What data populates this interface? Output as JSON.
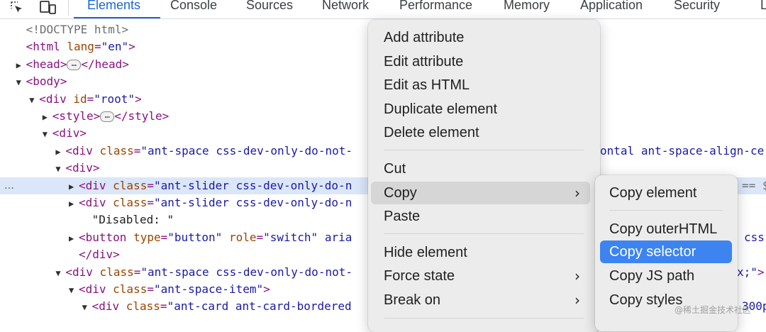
{
  "toolbar": {
    "tabs": [
      "Elements",
      "Console",
      "Sources",
      "Network",
      "Performance",
      "Memory",
      "Application",
      "Security",
      "L"
    ],
    "active_tab": "Elements",
    "accent_color": "#1a66d6"
  },
  "dom_tree": {
    "row_marker": "…",
    "lines": [
      {
        "indent": 1,
        "arrow": "",
        "code": "<!DOCTYPE html>"
      },
      {
        "indent": 1,
        "arrow": "",
        "code": "<html lang=\"en\">"
      },
      {
        "indent": 1,
        "arrow": "▶",
        "code": "<head>",
        "ellipsis": true,
        "code_after": "</head>"
      },
      {
        "indent": 1,
        "arrow": "▼",
        "code": "<body>"
      },
      {
        "indent": 2,
        "arrow": "▼",
        "code": "<div id=\"root\">"
      },
      {
        "indent": 3,
        "arrow": "▶",
        "code": "<style>",
        "ellipsis": true,
        "code_after": "</style>"
      },
      {
        "indent": 3,
        "arrow": "▼",
        "code": "<div>"
      },
      {
        "indent": 4,
        "arrow": "▶",
        "code": "<div class=\"ant-space css-dev-only-do-not-",
        "right": "ontal ant-space-align-ce"
      },
      {
        "indent": 4,
        "arrow": "▼",
        "code": "<div>"
      },
      {
        "indent": 5,
        "arrow": "▶",
        "code": "<div class=\"ant-slider css-dev-only-do-n",
        "right": "== $",
        "selected": true
      },
      {
        "indent": 5,
        "arrow": "▶",
        "code": "<div class=\"ant-slider css-dev-only-do-n"
      },
      {
        "indent": 6,
        "arrow": "",
        "code": "\"Disabled: \""
      },
      {
        "indent": 5,
        "arrow": "▶",
        "code": "<button type=\"button\" role=\"switch\" aria",
        "right": "css-"
      },
      {
        "indent": 5,
        "arrow": "",
        "code": "</div>"
      },
      {
        "indent": 4,
        "arrow": "▼",
        "code": "<div class=\"ant-space css-dev-only-do-not-",
        "right": "x;\">"
      },
      {
        "indent": 5,
        "arrow": "▼",
        "code": "<div class=\"ant-space-item\">"
      },
      {
        "indent": 6,
        "arrow": "▼",
        "code": "<div class=\"ant-card ant-card-bordered",
        "right": "300p"
      }
    ]
  },
  "context_menu": {
    "items": [
      {
        "label": "Add attribute"
      },
      {
        "label": "Edit attribute"
      },
      {
        "label": "Edit as HTML"
      },
      {
        "label": "Duplicate element"
      },
      {
        "label": "Delete element"
      },
      {
        "label": "Cut"
      },
      {
        "label": "Copy",
        "submenu": true,
        "hover": true
      },
      {
        "label": "Paste"
      },
      {
        "label": "Hide element"
      },
      {
        "label": "Force state",
        "submenu": true
      },
      {
        "label": "Break on",
        "submenu": true
      }
    ],
    "chevron": "›"
  },
  "copy_submenu": {
    "items": [
      {
        "label": "Copy element"
      },
      {
        "label": "Copy outerHTML"
      },
      {
        "label": "Copy selector",
        "highlight": true
      },
      {
        "label": "Copy JS path"
      },
      {
        "label": "Copy styles"
      }
    ],
    "highlight_color": "#3d84f1"
  },
  "watermark": "@稀土掘金技术社区"
}
